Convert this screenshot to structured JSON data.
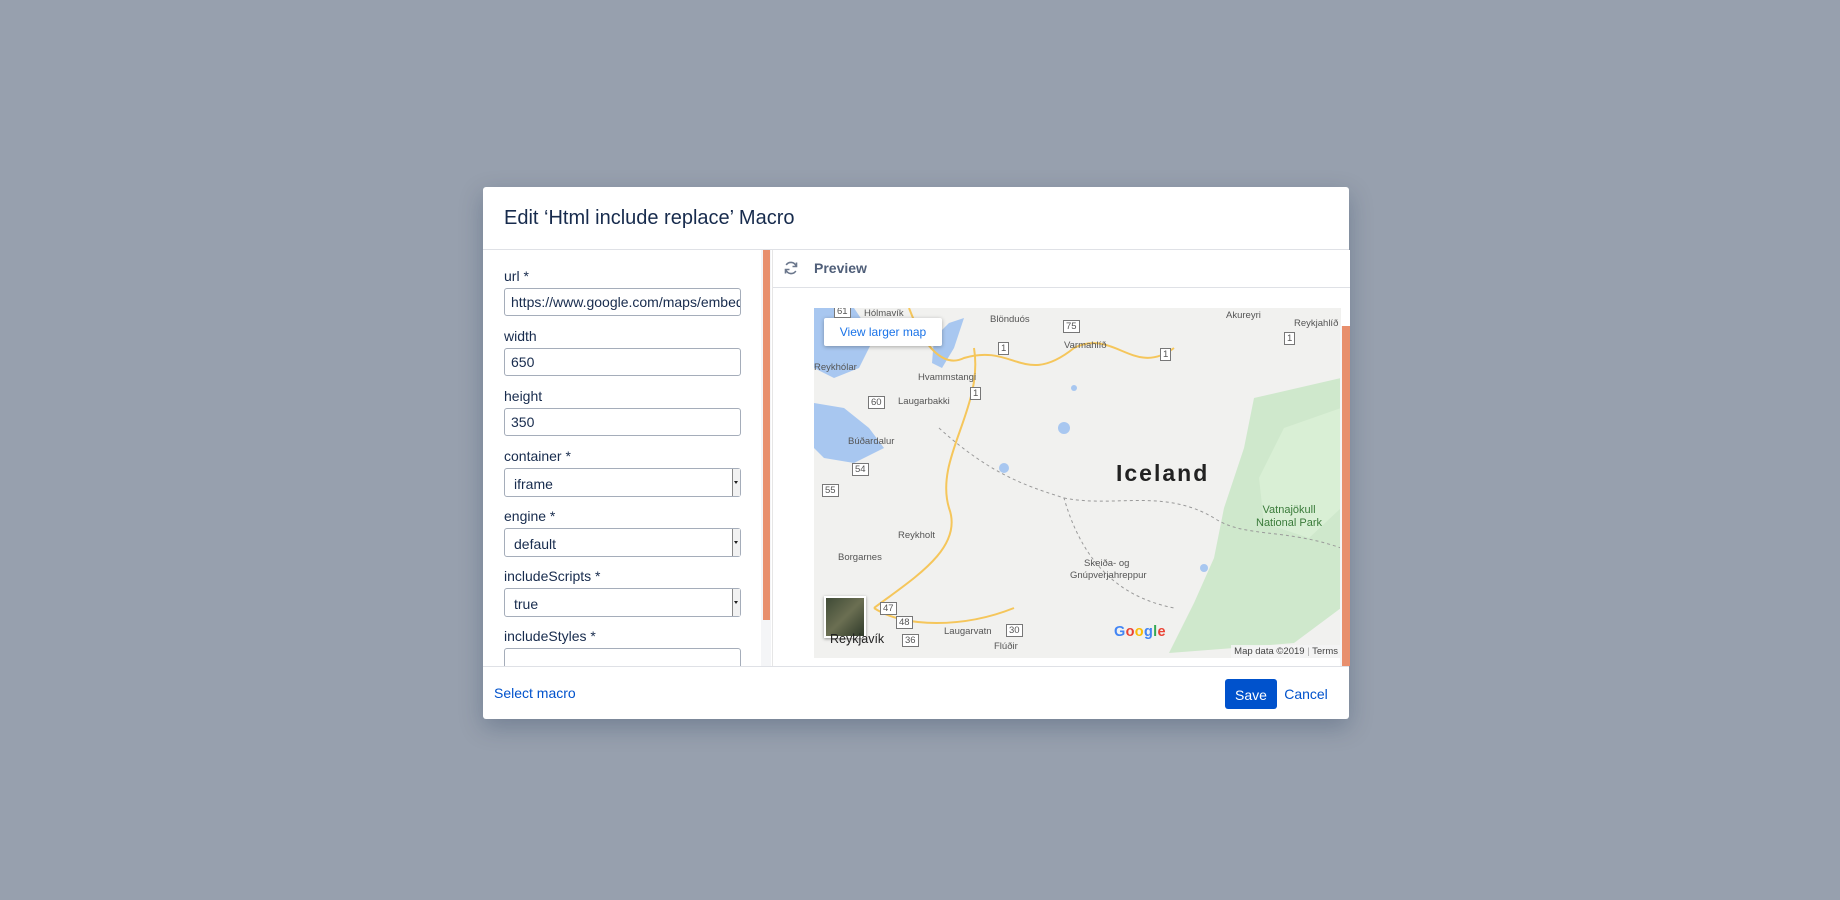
{
  "dialog": {
    "title": "Edit ‘Html include replace’ Macro"
  },
  "form": {
    "fields": [
      {
        "label": "url *",
        "value": "https://www.google.com/maps/embed"
      },
      {
        "label": "width",
        "value": "650"
      },
      {
        "label": "height",
        "value": "350"
      },
      {
        "label": "container *",
        "value": "iframe"
      },
      {
        "label": "engine *",
        "value": "default"
      },
      {
        "label": "includeScripts *",
        "value": "true"
      },
      {
        "label": "includeStyles *",
        "value": ""
      }
    ]
  },
  "preview": {
    "label": "Preview",
    "icon": "refresh-icon"
  },
  "map": {
    "view_larger": "View larger map",
    "country": "Iceland",
    "park": "Vatnajökull National Park",
    "park_line1": "Vatnajökull",
    "park_line2": "National Park",
    "city": "Reykjavík",
    "google": "Google",
    "footer_data": "Map data ©2019",
    "footer_terms": "Terms",
    "places": [
      "Hólmavík",
      "Blönduós",
      "Varmahlíð",
      "Akureyri",
      "Reykjahlíð",
      "Reykhólar",
      "Hvammstangi",
      "Laugarbakki",
      "Búðardalur",
      "Reykholt",
      "Borgarnes",
      "Laugarvatn",
      "Flúðir",
      "Skeiða- og",
      "Gnúpverjahreppur"
    ],
    "roads": [
      "61",
      "75",
      "1",
      "1",
      "1",
      "1",
      "60",
      "54",
      "55",
      "47",
      "48",
      "36",
      "30"
    ]
  },
  "footer": {
    "select_macro": "Select macro",
    "save": "Save",
    "cancel": "Cancel"
  },
  "colors": {
    "backdrop": "#97a0ae",
    "primary": "#0052cc",
    "scroll_accent": "#e88f6d"
  }
}
